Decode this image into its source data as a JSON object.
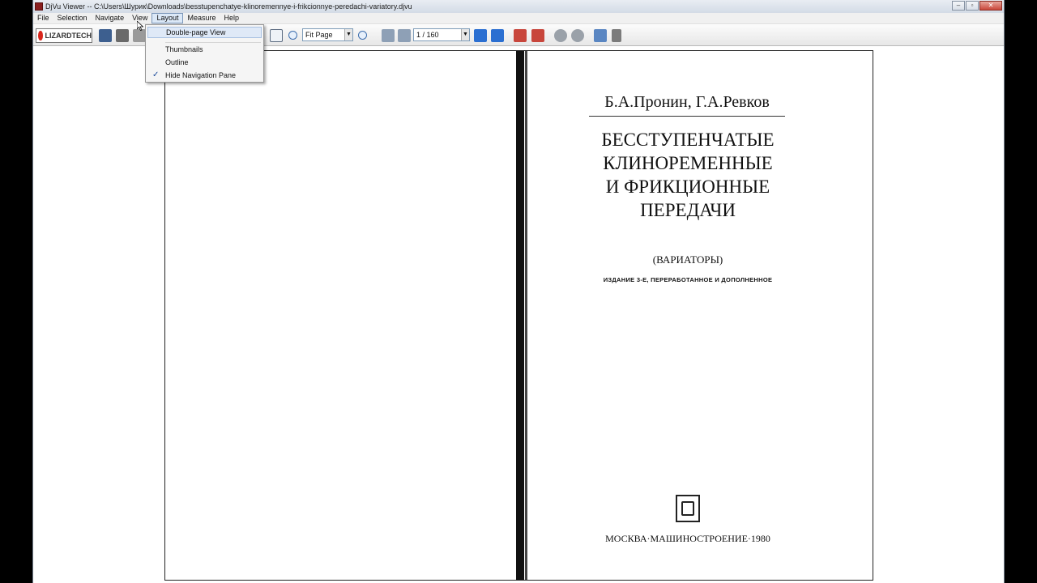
{
  "window": {
    "title": "DjVu Viewer -- C:\\Users\\Шурик\\Downloads\\besstupenchatye-klinoremennye-i-frikcionnye-peredachi-variatory.djvu"
  },
  "menubar": {
    "items": [
      "File",
      "Selection",
      "Navigate",
      "View",
      "Layout",
      "Measure",
      "Help"
    ]
  },
  "toolbar": {
    "logo_text": "LIZARDTECH",
    "zoom_value": "Fit Page",
    "page_value": "1 / 160"
  },
  "layout_menu": {
    "items": [
      "Double-page View",
      "Thumbnails",
      "Outline",
      "Hide Navigation Pane"
    ],
    "checked": "Hide Navigation Pane"
  },
  "document": {
    "authors": "Б.А.Пронин, Г.А.Ревков",
    "title_lines": [
      "БЕССТУПЕНЧАТЫЕ",
      "КЛИНОРЕМЕННЫЕ",
      "И ФРИКЦИОННЫЕ",
      "ПЕРЕДАЧИ"
    ],
    "subtitle": "(ВАРИАТОРЫ)",
    "edition": "ИЗДАНИЕ 3-Е, ПЕРЕРАБОТАННОЕ И ДОПОЛНЕННОЕ",
    "imprint": "МОСКВА·МАШИНОСТРОЕНИЕ·1980"
  },
  "colors": {
    "accent": "#dbe8f7",
    "logo_red": "#d9261c"
  }
}
